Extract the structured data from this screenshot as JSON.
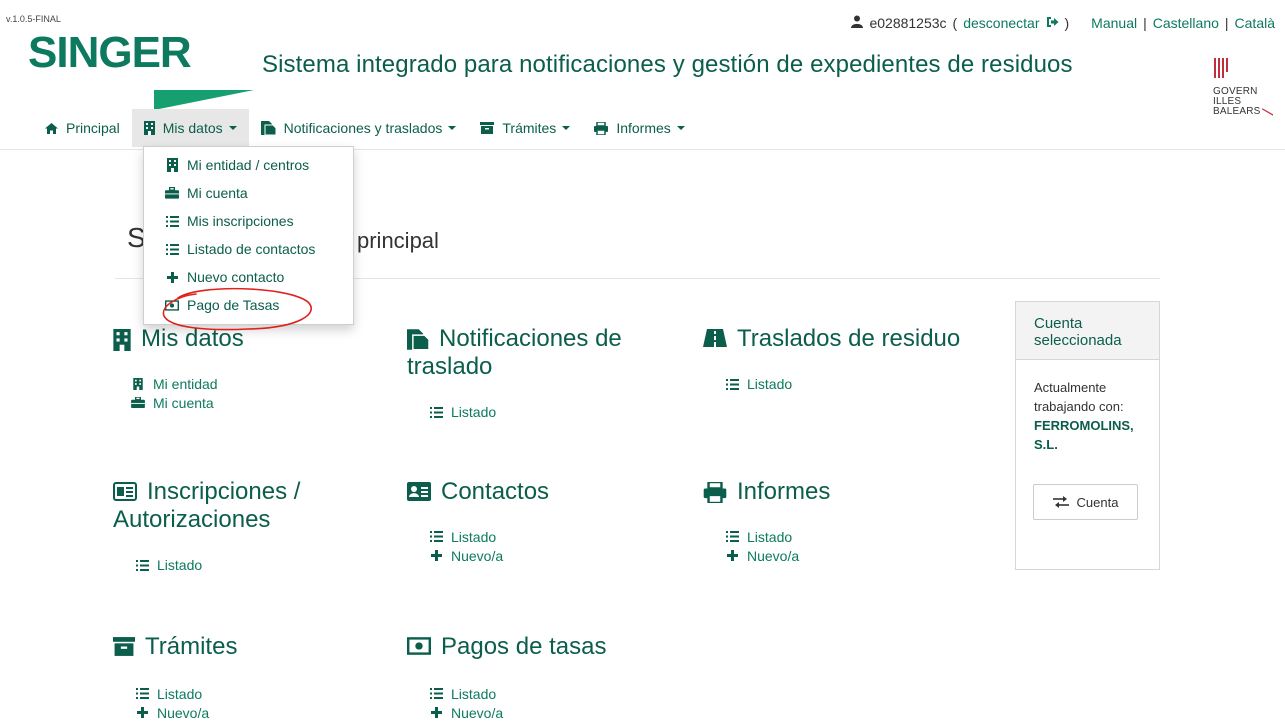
{
  "header": {
    "version": "v.1.0.5-FINAL",
    "logo_text": "SINGER",
    "system_title": "Sistema integrado para notificaciones y gestión de expedientes de residuos",
    "user": {
      "id": "e02881253c",
      "disconnect_prefix": "(",
      "disconnect_label": "desconectar",
      "disconnect_suffix": ")"
    },
    "links": [
      "Manual",
      "Castellano",
      "Català"
    ],
    "separator": "|",
    "govern_lines": [
      "GOVERN",
      "ILLES",
      "BALEARS"
    ]
  },
  "nav": {
    "items": [
      {
        "label": "Principal",
        "icon": "home-icon"
      },
      {
        "label": "Mis datos",
        "icon": "building-icon"
      },
      {
        "label": "Notificaciones y traslados",
        "icon": "clipboard-icon"
      },
      {
        "label": "Trámites",
        "icon": "archive-icon"
      },
      {
        "label": "Informes",
        "icon": "print-icon"
      }
    ]
  },
  "dropdown": {
    "items": [
      {
        "label": "Mi entidad / centros",
        "icon": "building-icon"
      },
      {
        "label": "Mi cuenta",
        "icon": "briefcase-icon"
      },
      {
        "label": "Mis inscripciones",
        "icon": "list-icon"
      },
      {
        "label": "Listado de contactos",
        "icon": "list-icon"
      },
      {
        "label": "Nuevo contacto",
        "icon": "plus-icon"
      },
      {
        "label": "Pago de Tasas",
        "icon": "money-icon"
      }
    ]
  },
  "page": {
    "title_start": "S",
    "title_end": "principal"
  },
  "sections": {
    "mis_datos": {
      "title": "Mis datos",
      "links": [
        "Mi entidad",
        "Mi cuenta"
      ]
    },
    "notificaciones": {
      "title_line1": "Notificaciones de",
      "title_line2": "traslado",
      "links": [
        "Listado"
      ]
    },
    "traslados": {
      "title": "Traslados de residuo",
      "links": [
        "Listado"
      ]
    },
    "inscripciones": {
      "title_line1": "Inscripciones /",
      "title_line2": "Autorizaciones",
      "links": [
        "Listado"
      ]
    },
    "contactos": {
      "title": "Contactos",
      "links": [
        "Listado",
        "Nuevo/a"
      ]
    },
    "informes": {
      "title": "Informes",
      "links": [
        "Listado",
        "Nuevo/a"
      ]
    },
    "tramites": {
      "title": "Trámites",
      "links": [
        "Listado",
        "Nuevo/a"
      ]
    },
    "pagos": {
      "title": "Pagos de tasas",
      "links": [
        "Listado",
        "Nuevo/a"
      ]
    }
  },
  "panel": {
    "title_line1": "Cuenta",
    "title_line2": "seleccionada",
    "line1": "Actualmente",
    "line2": "trabajando con:",
    "company_line1": "FERROMOLINS,",
    "company_line2": "S.L.",
    "button_label": "Cuenta"
  },
  "colors": {
    "primary": "#0d7a5f",
    "dark": "#0b5e4b",
    "accent_triangle": "#16a06f",
    "annotation_red": "#e0201b",
    "govern_red": "#c0303b"
  }
}
